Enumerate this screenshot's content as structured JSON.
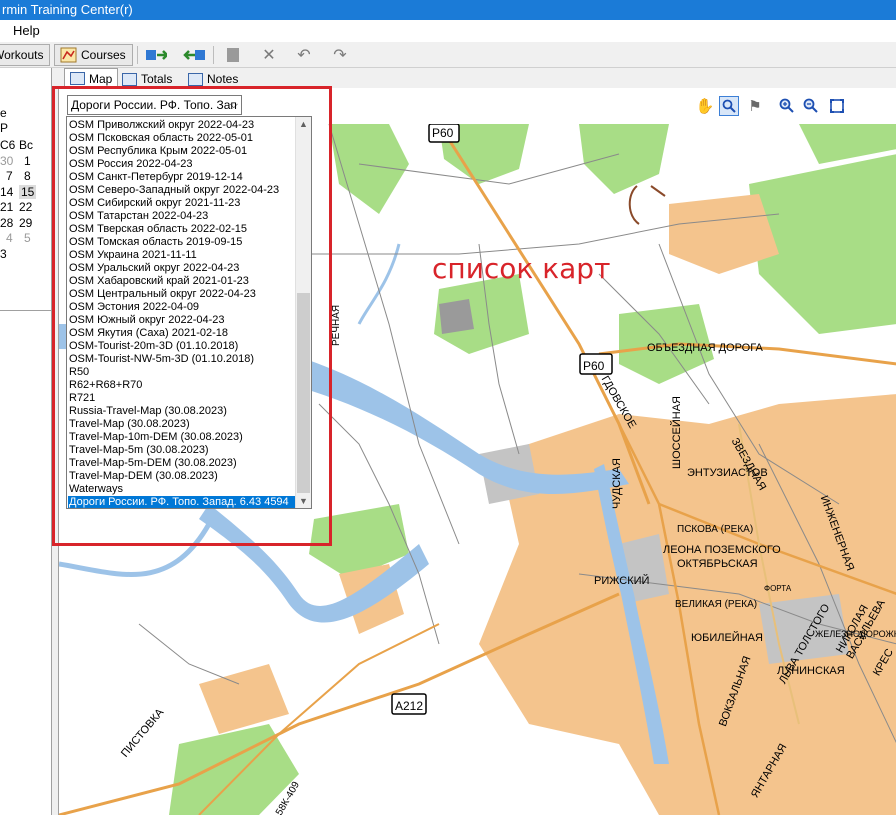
{
  "app": {
    "title": "rmin Training Center(r)"
  },
  "menu": {
    "help": "Help"
  },
  "toolbar": {
    "workouts_label": "Workouts",
    "courses_label": "Courses"
  },
  "calendar": {
    "header": [
      "C6",
      "Bc"
    ],
    "rows": [
      [
        "30",
        "1"
      ],
      [
        "7",
        "8"
      ],
      [
        "14",
        "15"
      ],
      [
        "21",
        "22"
      ],
      [
        "28",
        "29"
      ],
      [
        "4",
        "5"
      ],
      [
        "3",
        ""
      ]
    ],
    "left_a": "e",
    "left_b": "P"
  },
  "tabs": {
    "map": "Map",
    "totals": "Totals",
    "notes": "Notes"
  },
  "map_select": {
    "value": "Дороги России. РФ. Топо. Зап"
  },
  "map_list": {
    "items": [
      "OSM Приволжский округ 2022-04-23",
      "OSM Псковская область 2022-05-01",
      "OSM Республика Крым 2022-05-01",
      "OSM Россия 2022-04-23",
      "OSM Санкт-Петербург 2019-12-14",
      "OSM Северо-Западный округ 2022-04-23",
      "OSM Сибирский округ 2021-11-23",
      "OSM Татарстан 2022-04-23",
      "OSM Тверская область 2022-02-15",
      "OSM Томская область 2019-09-15",
      "OSM Украина 2021-11-11",
      "OSM Уральский округ 2022-04-23",
      "OSM Хабаровский край 2021-01-23",
      "OSM Центральный округ 2022-04-23",
      "OSM Эстония 2022-04-09",
      "OSM Южный округ 2022-04-23",
      "OSM Якутия (Саха) 2021-02-18",
      "OSM-Tourist-20m-3D (01.10.2018)",
      "OSM-Tourist-NW-5m-3D (01.10.2018)",
      "R50",
      "R62+R68+R70",
      "R721",
      "Russia-Travel-Map (30.08.2023)",
      "Travel-Map (30.08.2023)",
      "Travel-Map-10m-DEM (30.08.2023)",
      "Travel-Map-5m (30.08.2023)",
      "Travel-Map-5m-DEM (30.08.2023)",
      "Travel-Map-DEM (30.08.2023)",
      "Waterways",
      "Дороги России. РФ. Топо. Запад. 6.43 4594"
    ],
    "selected_index": 29
  },
  "annotation": "список карт",
  "map_labels": {
    "road_p60_top": "P60",
    "road_p60_mid": "P60",
    "road_a212": "A212",
    "obezdnaya": "ОБЪЕЗДНАЯ ДОРОГА",
    "entuziastov": "ЭНТУЗИАСТОВ",
    "pskova": "ПСКОВА (РЕКА)",
    "leona": "ЛЕОНА ПОЗЕМСКОГО",
    "oktyabrskaya": "ОКТЯБРЬСКАЯ",
    "velikaya": "ВЕЛИКАЯ (РЕКА)",
    "yubileynaya": "ЮБИЛЕЙНАЯ",
    "luninskaya": "ЛУНИНСКАЯ",
    "rizhskiy": "РИЖСКИЙ",
    "chudskaya": "ЧУДСКАЯ",
    "shosseynaya": "ШОССЕЙНАЯ",
    "zvezdnaya": "ЗВЕЗДНАЯ",
    "pistovka": "ПИСТОВКА",
    "zheleznodor": "ЖЕЛЕЗНОДОРОЖНЫ",
    "gdovskoe": "ГДОВСКОЕ",
    "rechnaya": "РЕЧНАЯ",
    "vokzalnaya": "ВОКЗАЛЬНАЯ",
    "inzhenernaya": "ИНЖЕНЕРНАЯ",
    "tolstogo": "ЛЬВА ТОЛСТОГО",
    "nikolaya": "НИКОЛАЯ ВАСИЛЬЕВА",
    "krest": "КРЕС",
    "yantarnaya": "ЯНТАРНАЯ",
    "k409": "58К-409",
    "fort": "ФОРТА"
  },
  "colors": {
    "water": "#9dc3e8",
    "forest": "#a8dd86",
    "urban": "#f4c48d",
    "industrial": "#c4c4c4",
    "annotation": "#d8242a"
  }
}
